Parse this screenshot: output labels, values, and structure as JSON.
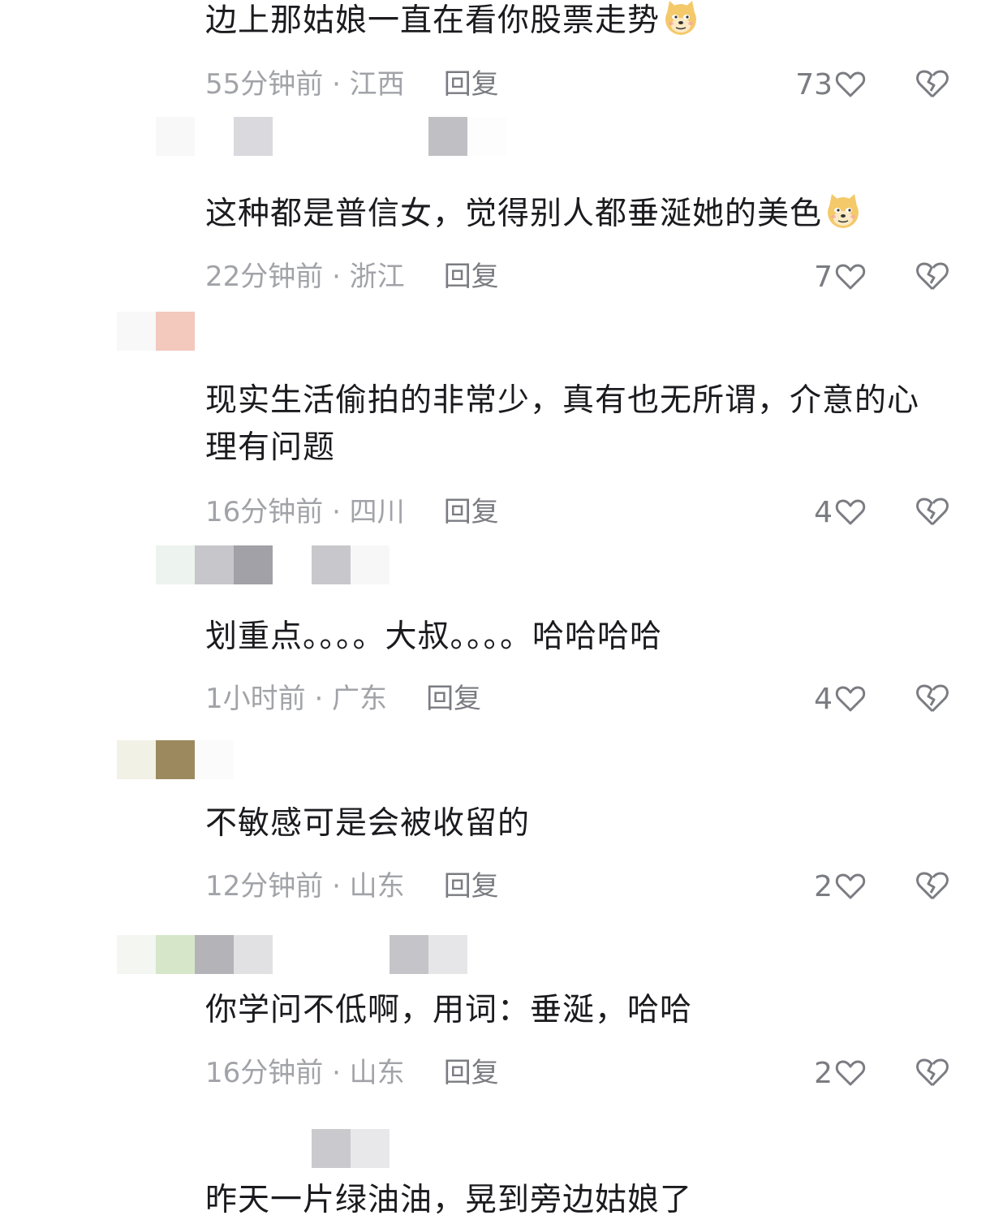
{
  "comments": [
    {
      "text": "边上那姑娘一直在看你股票走势",
      "emoji": "doge-emoji",
      "time_location": "55分钟前 · 江西",
      "reply": "回复",
      "likes": "73",
      "username_pixels": [
        "#f7f8f7",
        "#dadade",
        "#ffffff",
        "#ffffff",
        "#c0c0c4",
        "#fdfdfd"
      ]
    },
    {
      "text": "这种都是普信女，觉得别人都垂涎她的美色",
      "emoji": "doge-emoji",
      "time_location": "22分钟前 · 浙江",
      "reply": "回复",
      "likes": "7",
      "username_pixels": [
        "#f8f8f8",
        "#f3c8bd"
      ]
    },
    {
      "text": "现实生活偷拍的非常少，真有也无所谓，介意的心理有问题",
      "emoji": "",
      "time_location": "16分钟前 · 四川",
      "reply": "回复",
      "likes": "4",
      "username_pixels": [
        "#edf3ee",
        "#c7c7cb",
        "#a1a1a7",
        "#ffffff",
        "#c8c8cc",
        "#f7f7f7"
      ]
    },
    {
      "text": "划重点。。。。大叔。。。。哈哈哈哈",
      "emoji": "",
      "time_location": "1小时前 · 广东",
      "reply": "回复",
      "likes": "4",
      "username_pixels": [
        "#f2f1e6",
        "#9c8a5e",
        "#fbfbfb"
      ]
    },
    {
      "text": "不敏感可是会被收留的",
      "emoji": "",
      "time_location": "12分钟前 · 山东",
      "reply": "回复",
      "likes": "2",
      "username_pixels": [
        "#f3f6f1",
        "#d6e7c9",
        "#b4b4b8",
        "#e1e1e3",
        "#ffffff",
        "#ffffff",
        "#c5c5c9",
        "#e6e6e8"
      ]
    },
    {
      "text": "你学问不低啊，用词：垂涎，哈哈",
      "emoji": "",
      "time_location": "16分钟前 · 山东",
      "reply": "回复",
      "likes": "2",
      "username_pixels": [
        "#ffffff",
        "#f8f8f8",
        "#ffffff",
        "#cacace",
        "#e8e8ea"
      ]
    }
  ],
  "partial_comment": {
    "text": "昨天一片绿油油，晃到旁边姑娘了"
  },
  "colors": {
    "text": "#1b1b1f",
    "meta": "#a2a3a8",
    "reply": "#7b7c82",
    "icon": "#7b7c82"
  },
  "icons": {
    "like": "heart-outline-icon",
    "dislike": "broken-heart-icon"
  }
}
